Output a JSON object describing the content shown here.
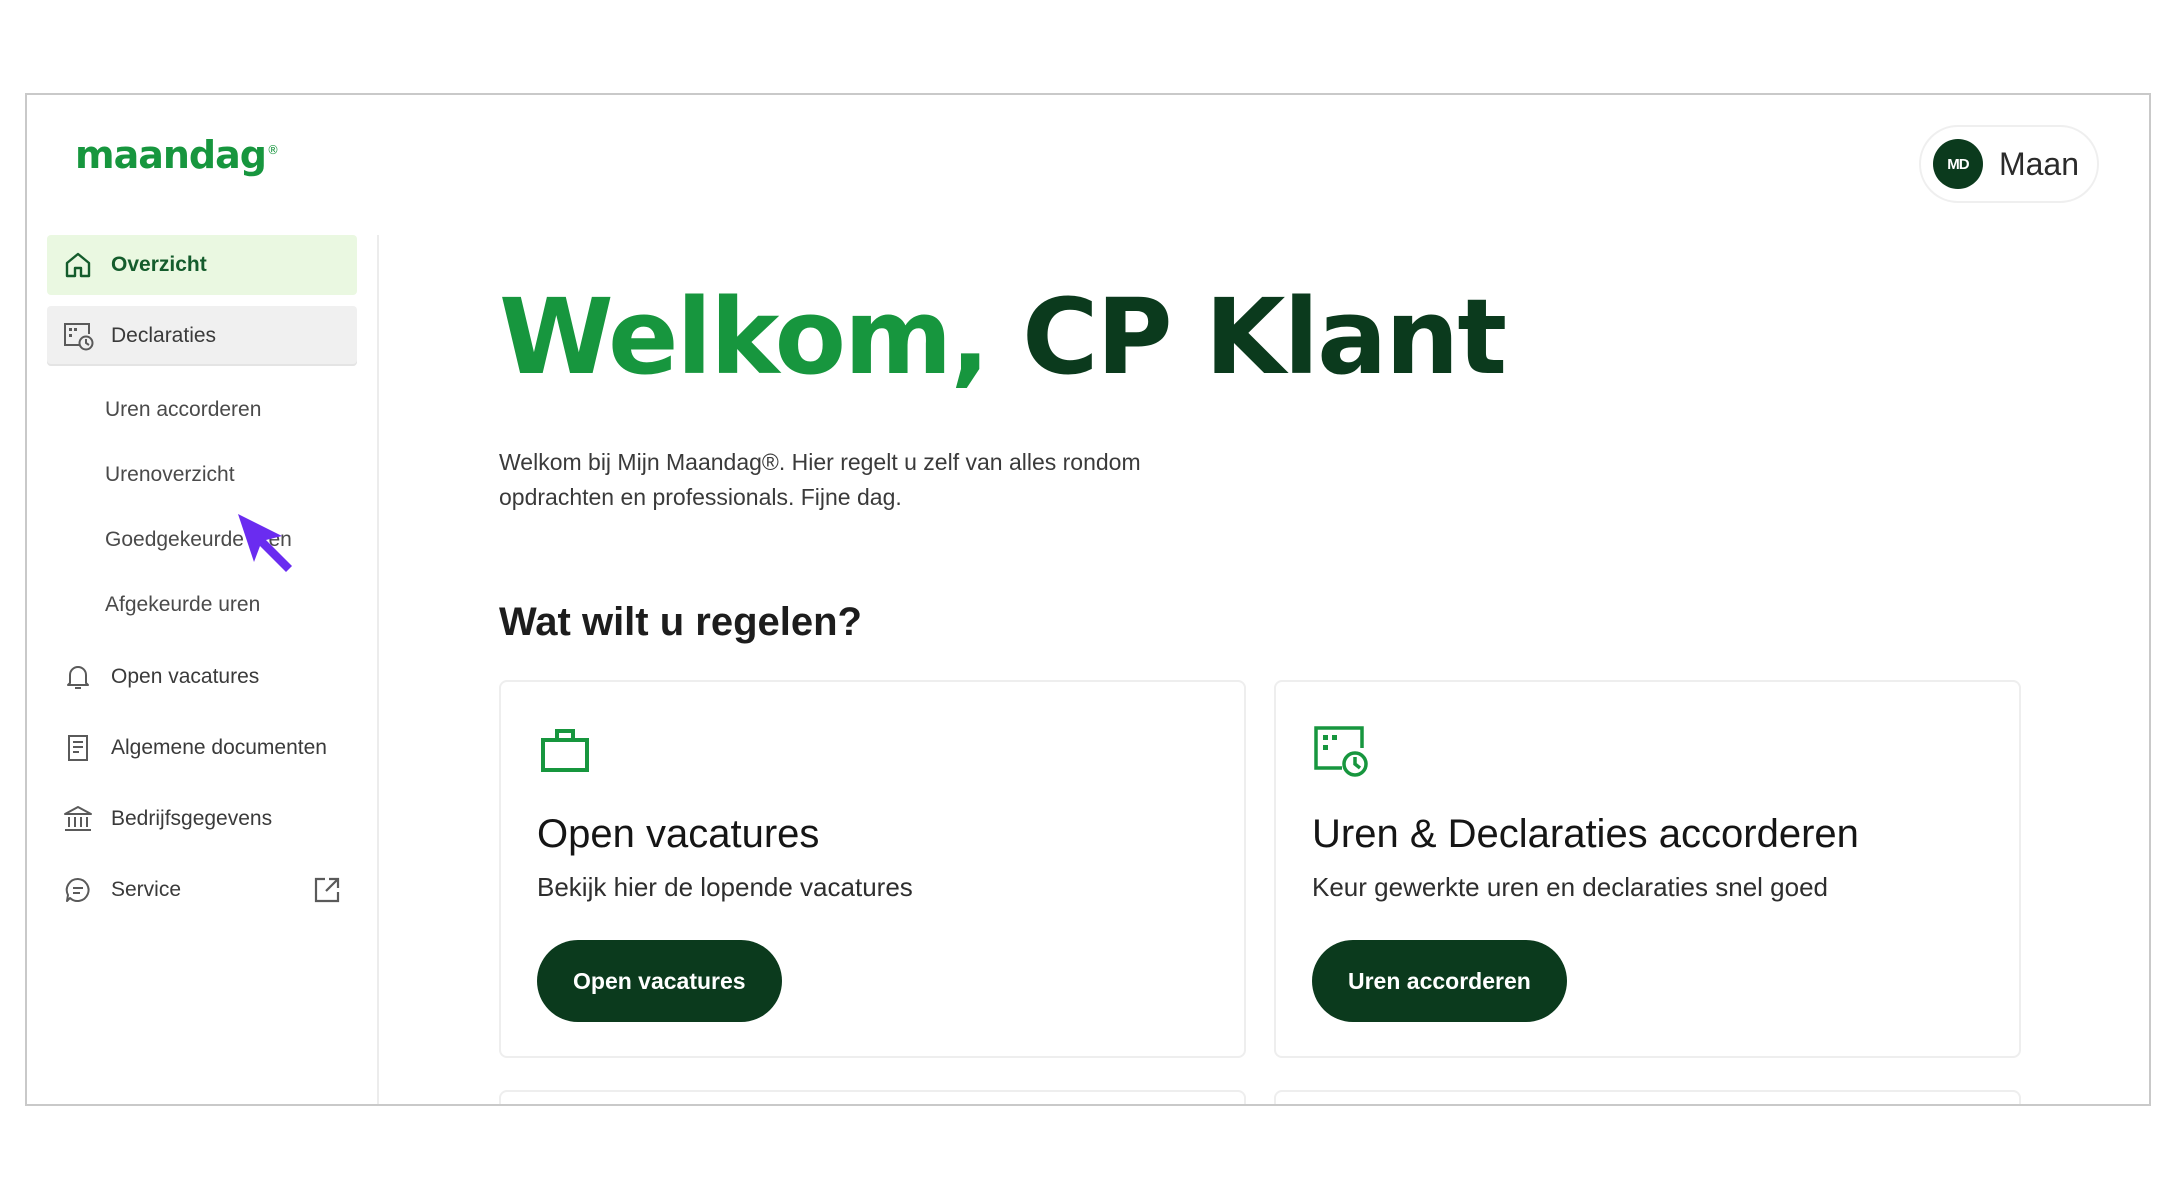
{
  "brand": {
    "logo_text": "maandag",
    "logo_mark": "®",
    "color": "#17963e"
  },
  "user": {
    "initials": "MD",
    "name": "Maan"
  },
  "sidebar": {
    "items": [
      {
        "label": "Overzicht",
        "icon": "home-icon",
        "state": "active"
      },
      {
        "label": "Declaraties",
        "icon": "declaration-clock-icon",
        "state": "hover"
      },
      {
        "label": "Open vacatures",
        "icon": "bell-icon"
      },
      {
        "label": "Algemene documenten",
        "icon": "document-icon"
      },
      {
        "label": "Bedrijfsgegevens",
        "icon": "bank-building-icon"
      },
      {
        "label": "Service",
        "icon": "chat-icon",
        "trailing_icon": "external-link-icon"
      }
    ],
    "sub_items": [
      "Uren accorderen",
      "Urenoverzicht",
      "Goedgekeurde uren",
      "Afgekeurde uren"
    ]
  },
  "main": {
    "welcome_greeting": "Welkom,",
    "welcome_name": "CP Klant",
    "intro_line1": "Welkom bij Mijn Maandag®. Hier regelt u zelf van alles rondom",
    "intro_line2": "opdrachten en professionals. Fijne dag.",
    "section_title": "Wat wilt u regelen?",
    "cards": [
      {
        "icon": "briefcase-icon",
        "title": "Open vacatures",
        "description": "Bekijk hier de lopende vacatures",
        "button": "Open vacatures"
      },
      {
        "icon": "declaration-clock-icon",
        "title": "Uren & Declaraties accorderen",
        "description": "Keur gewerkte uren en declaraties snel goed",
        "button": "Uren accorderen"
      }
    ]
  },
  "colors": {
    "brand_green": "#17963e",
    "dark_green": "#0b3a1d",
    "active_bg": "#eaf8e1",
    "cursor": "#6a2cf0"
  }
}
